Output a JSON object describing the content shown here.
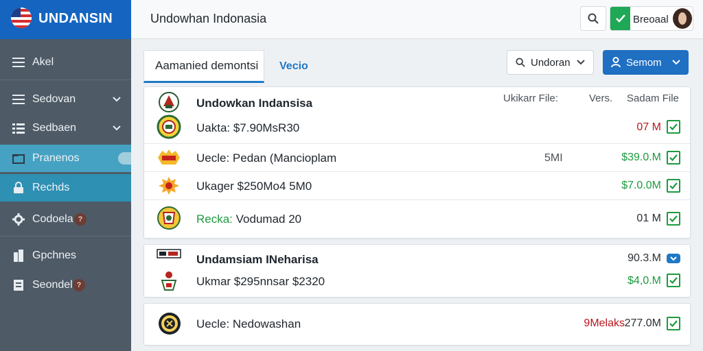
{
  "brand": {
    "name": "UNDANSIN"
  },
  "sidebar": {
    "items": [
      {
        "label": "Akel",
        "icon": "menu-icon"
      },
      {
        "label": "Sedovan",
        "icon": "list-icon"
      },
      {
        "label": "Sedbaen",
        "icon": "grid-list-icon"
      },
      {
        "label": "Pranenos",
        "icon": "folder-icon"
      },
      {
        "label": "Rechds",
        "icon": "lock-icon"
      },
      {
        "label": "Codoela",
        "icon": "gear-icon",
        "badge": "?"
      },
      {
        "label": "Gpchnes",
        "icon": "building-icon"
      },
      {
        "label": "Seondel",
        "icon": "document-icon",
        "badge": "?"
      }
    ]
  },
  "header": {
    "title": "Undowhan Indonasia",
    "user_name": "Breoaal"
  },
  "tabs": [
    {
      "label": "Aamanied demontsi"
    },
    {
      "label": "Vecio"
    }
  ],
  "filter": {
    "label": "Undoran"
  },
  "primary_action": {
    "label": "Semom"
  },
  "groups": [
    {
      "title": "Undowkan Indansisa",
      "headers": [
        "Ukikarr File:",
        "Vers.",
        "Sadam File"
      ],
      "rows": [
        {
          "text": "Uakta: $7.90MsR30",
          "amount": "07 M",
          "amount_color": "red"
        },
        {
          "text": "Uecle: Pedan (Mancioplam",
          "mid": "5MI",
          "amount": "$39.0.M",
          "amount_color": "green"
        },
        {
          "text": "Ukager $250Mo4 5M0",
          "amount": "$7.0.0M",
          "amount_color": "green"
        },
        {
          "text": "Recka: Vodumad 20",
          "text_prefix_green": "Recka:",
          "text_rest": " Vodumad 20",
          "amount": "01 M",
          "amount_color": "dark"
        }
      ]
    },
    {
      "title": "Undamsiam INeharisa",
      "rows": [
        {
          "amount": "90.3.M",
          "amount_color": "dark",
          "check": "blue"
        },
        {
          "text": "Ukmar $295nnsar $2320",
          "amount": "$4,0.M",
          "amount_color": "green"
        }
      ]
    },
    {
      "rows": [
        {
          "text": "Uecle: Nedowashan",
          "amount_red": "9Melaks",
          "amount": "277.0M",
          "amount_color": "dark"
        }
      ]
    }
  ],
  "colors": {
    "brand_blue": "#1565c0",
    "sidebar_bg": "#4e5a66",
    "active_teal": "#45a2c2",
    "accent_green": "#1c9a3f",
    "alert_red": "#b8161c"
  }
}
